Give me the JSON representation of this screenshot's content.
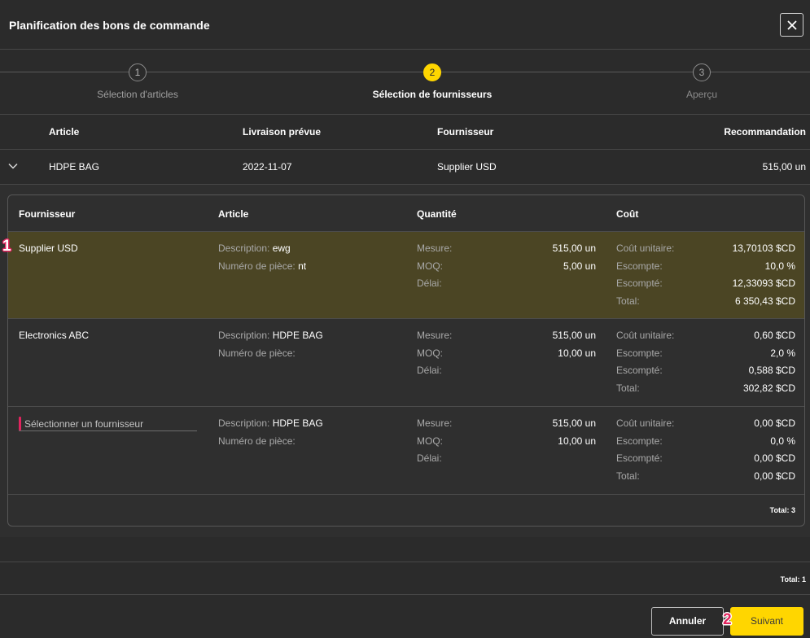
{
  "modal": {
    "title": "Planification des bons de commande"
  },
  "stepper": {
    "current_step": 2,
    "steps": [
      {
        "number": "1",
        "label": "Sélection d'articles"
      },
      {
        "number": "2",
        "label": "Sélection de fournisseurs"
      },
      {
        "number": "3",
        "label": "Aperçu"
      }
    ]
  },
  "main_table": {
    "headers": {
      "article": "Article",
      "delivery": "Livraison prévue",
      "supplier": "Fournisseur",
      "recommendation": "Recommandation"
    },
    "rows": [
      {
        "expanded": true,
        "article": "HDPE BAG",
        "delivery": "2022-11-07",
        "supplier": "Supplier USD",
        "recommendation": "515,00 un"
      }
    ],
    "total": "Total: 1"
  },
  "supplier_table": {
    "headers": {
      "supplier": "Fournisseur",
      "article": "Article",
      "quantity": "Quantité",
      "cost": "Coût"
    },
    "labels": {
      "description": "Description:",
      "part_number": "Numéro de pièce:",
      "measure": "Mesure:",
      "moq": "MOQ:",
      "lead_time": "Délai:",
      "unit_cost": "Coût unitaire:",
      "discount": "Escompte:",
      "discounted": "Escompté:",
      "total": "Total:"
    },
    "rows": [
      {
        "selected": true,
        "supplier": "Supplier USD",
        "description": "ewg",
        "part_number": "nt",
        "measure": "515,00 un",
        "moq": "5,00 un",
        "lead_time": "",
        "unit_cost": "13,70103 $CD",
        "discount": "10,0 %",
        "discounted": "12,33093 $CD",
        "total": "6 350,43 $CD"
      },
      {
        "selected": false,
        "supplier": "Electronics ABC",
        "description": "HDPE BAG",
        "part_number": "",
        "measure": "515,00 un",
        "moq": "10,00 un",
        "lead_time": "",
        "unit_cost": "0,60 $CD",
        "discount": "2,0 %",
        "discounted": "0,588 $CD",
        "total": "302,82 $CD"
      },
      {
        "selected": false,
        "supplier_placeholder": "Sélectionner un fournisseur",
        "description": "HDPE BAG",
        "part_number": "",
        "measure": "515,00 un",
        "moq": "10,00 un",
        "lead_time": "",
        "unit_cost": "0,00 $CD",
        "discount": "0,0 %",
        "discounted": "0,00 $CD",
        "total": "0,00 $CD"
      }
    ],
    "total": "Total: 3"
  },
  "footer": {
    "cancel_label": "Annuler",
    "next_label": "Suivant"
  },
  "annotations": {
    "marker_1": "1",
    "marker_2": "2"
  },
  "icons": {
    "close": "close-icon",
    "row_toggle": "chevron-down-icon"
  },
  "colors": {
    "accent": "#ffd600",
    "selected_row": "#4b4524",
    "required_marker": "#e0245e",
    "annotation": "#e0245e"
  }
}
